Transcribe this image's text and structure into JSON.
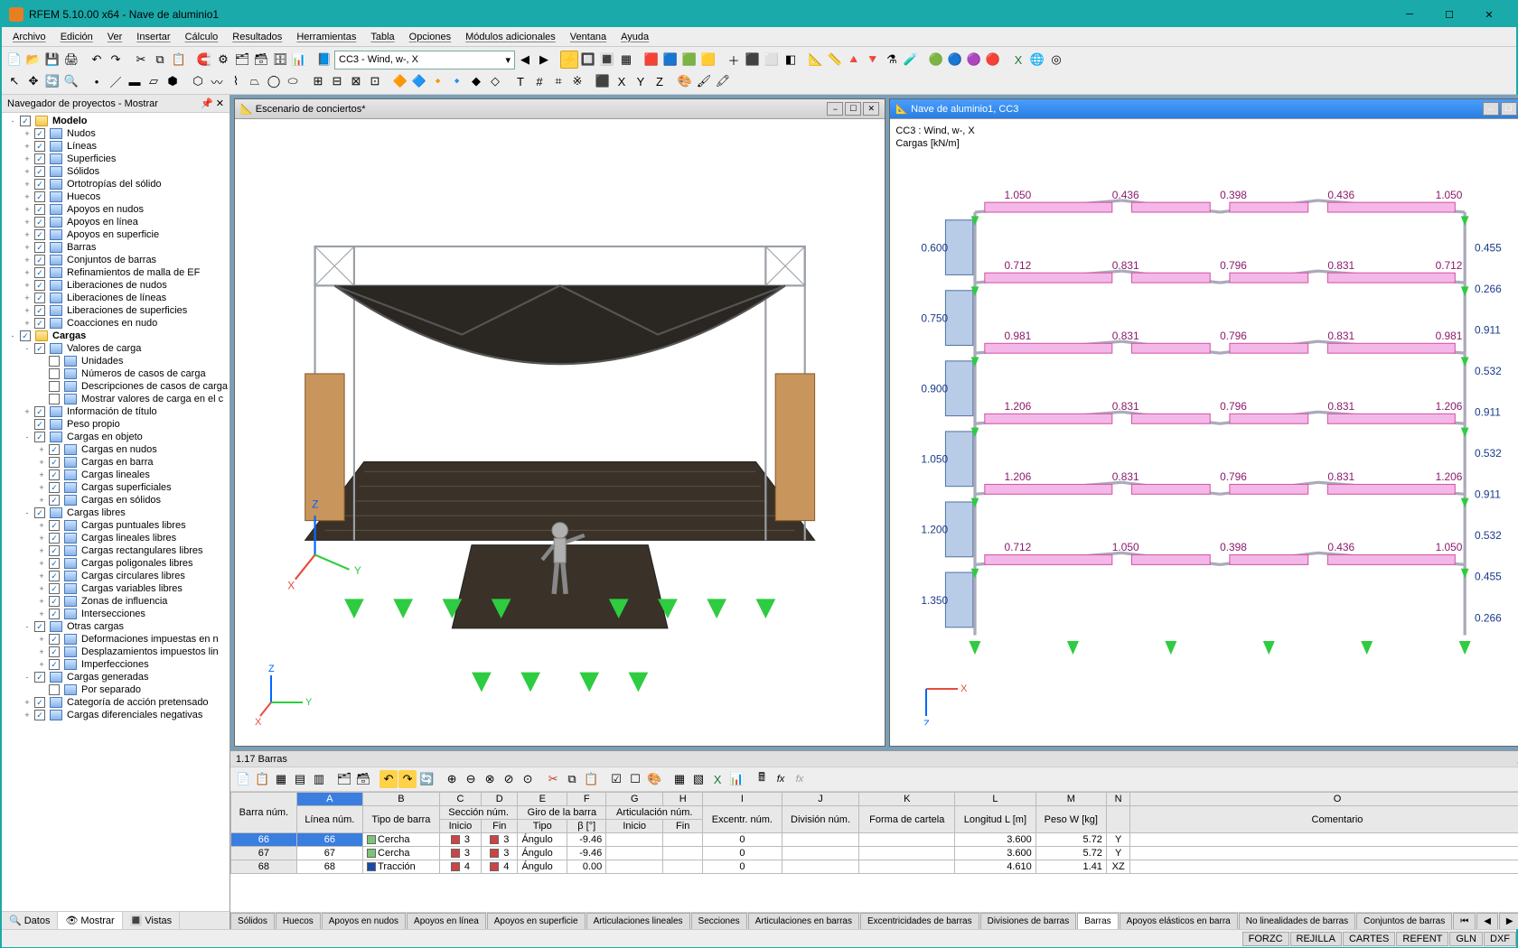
{
  "window": {
    "title": "RFEM 5.10.00 x64 - Nave de aluminio1"
  },
  "menu": [
    "Archivo",
    "Edición",
    "Ver",
    "Insertar",
    "Cálculo",
    "Resultados",
    "Herramientas",
    "Tabla",
    "Opciones",
    "Módulos adicionales",
    "Ventana",
    "Ayuda"
  ],
  "combo": {
    "loadcase": "CC3 - Wind, w-, X"
  },
  "navigator": {
    "title": "Navegador de proyectos - Mostrar",
    "tabs": [
      "Datos",
      "Mostrar",
      "Vistas"
    ],
    "active_tab": 1,
    "nodes": [
      {
        "d": 0,
        "exp": "-",
        "chk": true,
        "icon": "folder",
        "label": "Modelo",
        "bold": true
      },
      {
        "d": 1,
        "exp": "+",
        "chk": true,
        "icon": "item",
        "label": "Nudos"
      },
      {
        "d": 1,
        "exp": "+",
        "chk": true,
        "icon": "item",
        "label": "Líneas"
      },
      {
        "d": 1,
        "exp": "+",
        "chk": true,
        "icon": "item",
        "label": "Superficies"
      },
      {
        "d": 1,
        "exp": "+",
        "chk": true,
        "icon": "item",
        "label": "Sólidos"
      },
      {
        "d": 1,
        "exp": "+",
        "chk": true,
        "icon": "item",
        "label": "Ortotropías del sólido"
      },
      {
        "d": 1,
        "exp": "+",
        "chk": true,
        "icon": "item",
        "label": "Huecos"
      },
      {
        "d": 1,
        "exp": "+",
        "chk": true,
        "icon": "item",
        "label": "Apoyos en nudos"
      },
      {
        "d": 1,
        "exp": "+",
        "chk": true,
        "icon": "item",
        "label": "Apoyos en línea"
      },
      {
        "d": 1,
        "exp": "+",
        "chk": true,
        "icon": "item",
        "label": "Apoyos en superficie"
      },
      {
        "d": 1,
        "exp": "+",
        "chk": true,
        "icon": "item",
        "label": "Barras"
      },
      {
        "d": 1,
        "exp": "+",
        "chk": true,
        "icon": "item",
        "label": "Conjuntos de barras"
      },
      {
        "d": 1,
        "exp": "+",
        "chk": true,
        "icon": "item",
        "label": "Refinamientos de malla de EF"
      },
      {
        "d": 1,
        "exp": "+",
        "chk": true,
        "icon": "item",
        "label": "Liberaciones de nudos"
      },
      {
        "d": 1,
        "exp": "+",
        "chk": true,
        "icon": "item",
        "label": "Liberaciones de líneas"
      },
      {
        "d": 1,
        "exp": "+",
        "chk": true,
        "icon": "item",
        "label": "Liberaciones de superficies"
      },
      {
        "d": 1,
        "exp": "+",
        "chk": true,
        "icon": "item",
        "label": "Coacciones en nudo"
      },
      {
        "d": 0,
        "exp": "-",
        "chk": true,
        "icon": "folder",
        "label": "Cargas",
        "bold": true
      },
      {
        "d": 1,
        "exp": "-",
        "chk": true,
        "icon": "item",
        "label": "Valores de carga"
      },
      {
        "d": 2,
        "exp": "",
        "chk": false,
        "icon": "item",
        "label": "Unidades"
      },
      {
        "d": 2,
        "exp": "",
        "chk": false,
        "icon": "item",
        "label": "Números de casos de carga"
      },
      {
        "d": 2,
        "exp": "",
        "chk": false,
        "icon": "item",
        "label": "Descripciones de casos de carga"
      },
      {
        "d": 2,
        "exp": "",
        "chk": false,
        "icon": "item",
        "label": "Mostrar valores de carga en el c"
      },
      {
        "d": 1,
        "exp": "+",
        "chk": true,
        "icon": "item",
        "label": "Información de título"
      },
      {
        "d": 1,
        "exp": "",
        "chk": true,
        "icon": "item",
        "label": "Peso propio"
      },
      {
        "d": 1,
        "exp": "-",
        "chk": true,
        "icon": "item",
        "label": "Cargas en objeto"
      },
      {
        "d": 2,
        "exp": "+",
        "chk": true,
        "icon": "item",
        "label": "Cargas en nudos"
      },
      {
        "d": 2,
        "exp": "+",
        "chk": true,
        "icon": "item",
        "label": "Cargas en barra"
      },
      {
        "d": 2,
        "exp": "+",
        "chk": true,
        "icon": "item",
        "label": "Cargas lineales"
      },
      {
        "d": 2,
        "exp": "+",
        "chk": true,
        "icon": "item",
        "label": "Cargas superficiales"
      },
      {
        "d": 2,
        "exp": "+",
        "chk": true,
        "icon": "item",
        "label": "Cargas en sólidos"
      },
      {
        "d": 1,
        "exp": "-",
        "chk": true,
        "icon": "item",
        "label": "Cargas libres"
      },
      {
        "d": 2,
        "exp": "+",
        "chk": true,
        "icon": "item",
        "label": "Cargas puntuales libres"
      },
      {
        "d": 2,
        "exp": "+",
        "chk": true,
        "icon": "item",
        "label": "Cargas lineales libres"
      },
      {
        "d": 2,
        "exp": "+",
        "chk": true,
        "icon": "item",
        "label": "Cargas rectangulares libres"
      },
      {
        "d": 2,
        "exp": "+",
        "chk": true,
        "icon": "item",
        "label": "Cargas poligonales libres"
      },
      {
        "d": 2,
        "exp": "+",
        "chk": true,
        "icon": "item",
        "label": "Cargas circulares libres"
      },
      {
        "d": 2,
        "exp": "+",
        "chk": true,
        "icon": "item",
        "label": "Cargas variables libres"
      },
      {
        "d": 2,
        "exp": "+",
        "chk": true,
        "icon": "item",
        "label": "Zonas de influencia"
      },
      {
        "d": 2,
        "exp": "+",
        "chk": true,
        "icon": "item",
        "label": "Intersecciones"
      },
      {
        "d": 1,
        "exp": "-",
        "chk": true,
        "icon": "item",
        "label": "Otras cargas"
      },
      {
        "d": 2,
        "exp": "+",
        "chk": true,
        "icon": "item",
        "label": "Deformaciones impuestas en n"
      },
      {
        "d": 2,
        "exp": "+",
        "chk": true,
        "icon": "item",
        "label": "Desplazamientos impuestos lin"
      },
      {
        "d": 2,
        "exp": "+",
        "chk": true,
        "icon": "item",
        "label": "Imperfecciones"
      },
      {
        "d": 1,
        "exp": "-",
        "chk": true,
        "icon": "item",
        "label": "Cargas generadas"
      },
      {
        "d": 2,
        "exp": "",
        "chk": false,
        "icon": "item",
        "label": "Por separado"
      },
      {
        "d": 1,
        "exp": "+",
        "chk": true,
        "icon": "item",
        "label": "Categoría de acción pretensado"
      },
      {
        "d": 1,
        "exp": "+",
        "chk": true,
        "icon": "item",
        "label": "Cargas diferenciales negativas"
      }
    ]
  },
  "viewports": {
    "left": {
      "title": "Escenario de conciertos*"
    },
    "right": {
      "title": "Nave de aluminio1, CC3",
      "info1": "CC3 : Wind, w-, X",
      "info2": "Cargas [kN/m]"
    }
  },
  "table": {
    "title": "1.17 Barras",
    "cols_letters": [
      "A",
      "B",
      "C",
      "D",
      "E",
      "F",
      "G",
      "H",
      "I",
      "J",
      "K",
      "L",
      "M",
      "N",
      "O"
    ],
    "head1": [
      "Barra núm.",
      "Línea núm.",
      "Tipo de barra",
      "Sección núm.",
      "",
      "Giro de la barra",
      "",
      "Articulación núm.",
      "",
      "Excentr. núm.",
      "División núm.",
      "Forma de cartela",
      "Longitud L [m]",
      "Peso W [kg]",
      "",
      "Comentario"
    ],
    "head2": [
      "",
      "",
      "",
      "Inicio",
      "Fin",
      "Tipo",
      "β [°]",
      "Inicio",
      "Fin",
      "",
      "",
      "",
      "",
      "",
      "",
      ""
    ],
    "rows": [
      {
        "n": "66",
        "line": "66",
        "type": "Cercha",
        "sw": "#7cc576",
        "si": "3",
        "sf": "3",
        "gt": "Ángulo",
        "beta": "-9.46",
        "ai": "",
        "af": "",
        "ex": "0",
        "div": "",
        "car": "",
        "L": "3.600",
        "W": "5.72",
        "ax": "Y",
        "com": ""
      },
      {
        "n": "67",
        "line": "67",
        "type": "Cercha",
        "sw": "#7cc576",
        "si": "3",
        "sf": "3",
        "gt": "Ángulo",
        "beta": "-9.46",
        "ai": "",
        "af": "",
        "ex": "0",
        "div": "",
        "car": "",
        "L": "3.600",
        "W": "5.72",
        "ax": "Y",
        "com": ""
      },
      {
        "n": "68",
        "line": "68",
        "type": "Tracción",
        "sw": "#1a4aa8",
        "si": "4",
        "sf": "4",
        "gt": "Ángulo",
        "beta": "0.00",
        "ai": "",
        "af": "",
        "ex": "0",
        "div": "",
        "car": "",
        "L": "4.610",
        "W": "1.41",
        "ax": "XZ",
        "com": ""
      }
    ],
    "tabs": [
      "Sólidos",
      "Huecos",
      "Apoyos en nudos",
      "Apoyos en línea",
      "Apoyos en superficie",
      "Articulaciones lineales",
      "Secciones",
      "Articulaciones en barras",
      "Excentricidades de barras",
      "Divisiones de barras",
      "Barras",
      "Apoyos elásticos en barra",
      "No linealidades de barras",
      "Conjuntos de barras"
    ],
    "active_tab": 10
  },
  "status": [
    "FORZC",
    "REJILLA",
    "CARTES",
    "REFENT",
    "GLN",
    "DXF"
  ]
}
